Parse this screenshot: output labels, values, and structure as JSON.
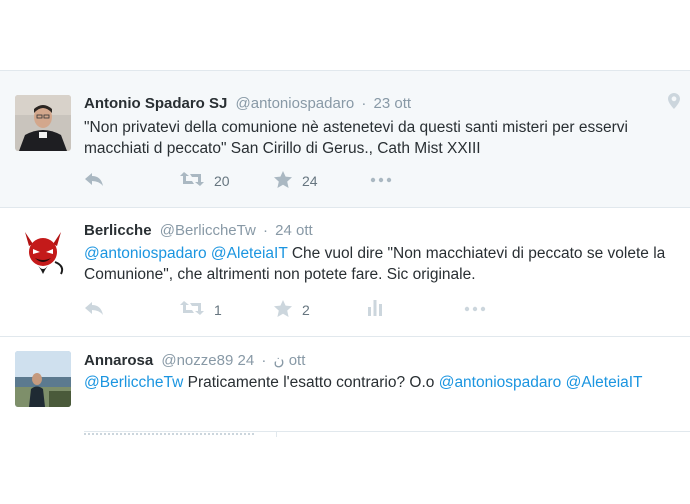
{
  "tweets": [
    {
      "name": "Antonio Spadaro SJ",
      "handle": "@antoniospadaro",
      "time": "23 ott",
      "text_parts": [
        "\"Non privatevi della comunione nè astenetevi da questi santi misteri per esservi macchiati d peccato\" San Cirillo di Gerus., Cath Mist XXIII"
      ],
      "retweets": "20",
      "likes": "24",
      "icons": [
        "reply-icon",
        "retweet-icon",
        "star-icon",
        "more-icon",
        "location-pin-icon"
      ]
    },
    {
      "name": "Berlicche",
      "handle": "@BerliccheTw",
      "time": "24 ott",
      "mentions": [
        "@antoniospadaro",
        "@AleteiaIT"
      ],
      "text": "Che vuol dire \"Non macchiatevi di peccato se volete la Comunione\", che altrimenti non potete fare. Sic originale.",
      "retweets": "1",
      "likes": "2",
      "icons": [
        "reply-icon",
        "retweet-icon",
        "star-icon",
        "stats-icon",
        "more-icon"
      ]
    },
    {
      "name": "Annarosa",
      "handle": "@nozze89",
      "handle_glyph": "ن",
      "time": "24 ott",
      "mention_start": "@BerliccheTw",
      "text": "Praticamente l'esatto contrario? O.o",
      "mention_end_1": "@antoniospadaro",
      "mention_end_2": "@AleteiaIT"
    }
  ],
  "colors": {
    "link": "#1b95e0",
    "text": "#292f33",
    "meta": "#8899a6",
    "icon": "#aab8c2",
    "border": "#e1e8ed"
  }
}
